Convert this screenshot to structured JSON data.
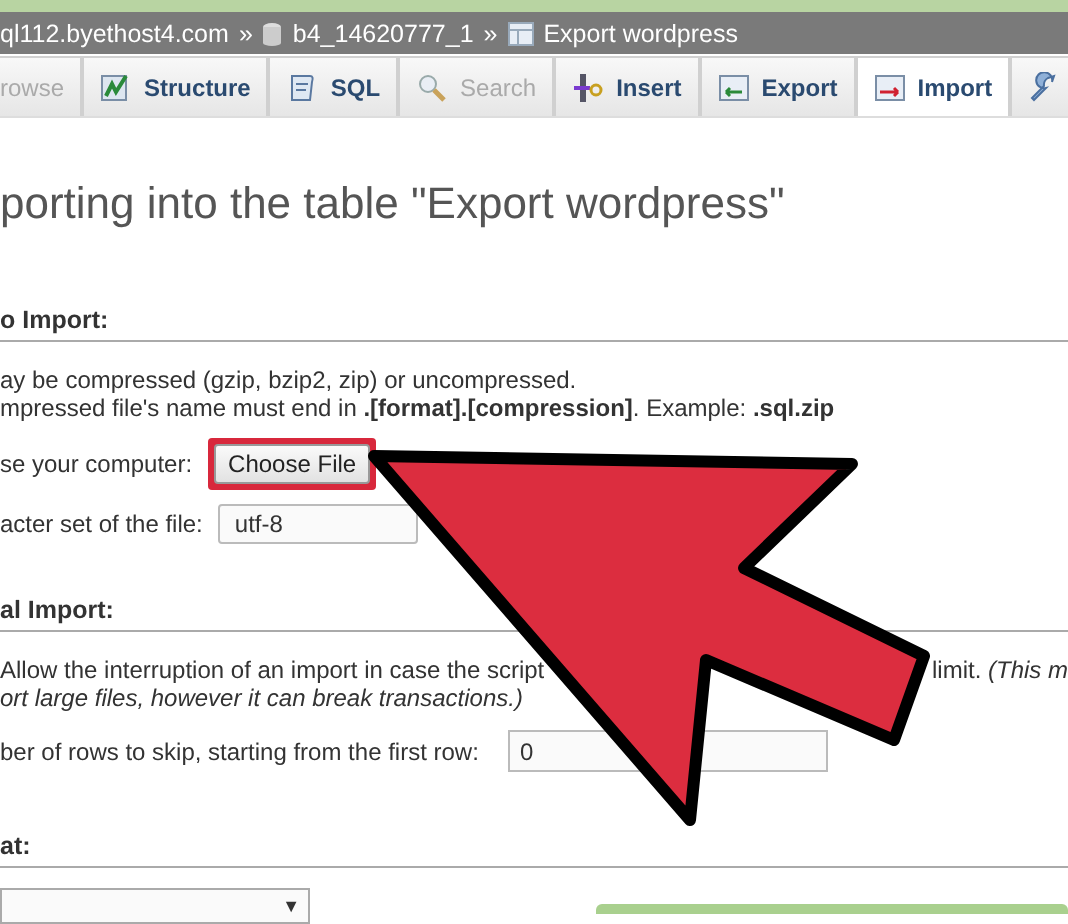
{
  "breadcrumb": [
    {
      "kind": "server",
      "label": "ql112.byethost4.com"
    },
    {
      "kind": "database",
      "label": "b4_14620777_1"
    },
    {
      "kind": "table",
      "label": "Export wordpress"
    }
  ],
  "breadcrumb_separator": "»",
  "tabs": [
    {
      "kind": "browse",
      "label": "rowse",
      "selected": false,
      "disabled": true
    },
    {
      "kind": "structure",
      "label": "Structure",
      "selected": false,
      "disabled": false
    },
    {
      "kind": "sql",
      "label": "SQL",
      "selected": false,
      "disabled": false
    },
    {
      "kind": "search",
      "label": "Search",
      "selected": false,
      "disabled": true
    },
    {
      "kind": "insert",
      "label": "Insert",
      "selected": false,
      "disabled": false
    },
    {
      "kind": "export",
      "label": "Export",
      "selected": false,
      "disabled": false
    },
    {
      "kind": "import",
      "label": "Import",
      "selected": true,
      "disabled": false
    },
    {
      "kind": "operations",
      "selected": false,
      "disabled": false
    }
  ],
  "heading": "porting into the table \"Export wordpress\"",
  "file_section": {
    "title": "o Import:",
    "notes": [
      "ay be compressed (gzip, bzip2, zip) or uncompressed.",
      "mpressed file's name must end in **.[format].[compression]**. Example: **.sql.zip**"
    ],
    "browse_label": "se your computer:",
    "choose_button": "Choose File",
    "highlighted": true,
    "charset_label": "acter set of the file:",
    "charset_value": "utf-8"
  },
  "partial_section": {
    "title": "al Import:",
    "interrupt_text": "Allow the interruption of an import in case the script",
    "interrupt_tail": "limit. *(This m*",
    "interrupt_line2": "ort large files, however it can break transactions.)",
    "skip_label": "ber of rows to skip, starting from the first row:",
    "skip_value": "0"
  },
  "format_section": {
    "title": "at:",
    "dropdown_arrow": "▼"
  }
}
